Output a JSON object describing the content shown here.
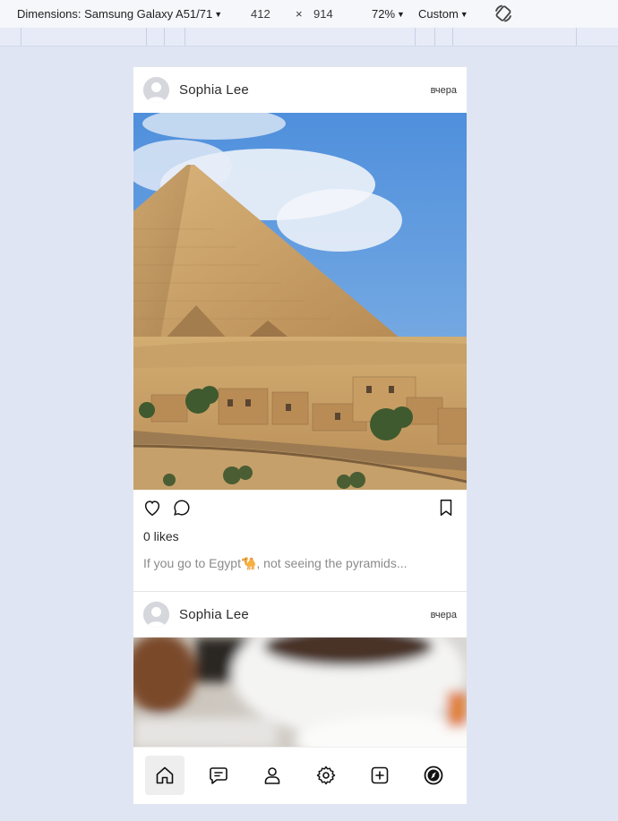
{
  "devtools": {
    "device_label": "Dimensions: Samsung Galaxy A51/71",
    "width": "412",
    "times": "×",
    "height": "914",
    "zoom": "72%",
    "throttle": "Custom",
    "icons": [
      "chevron-down-icon",
      "rotate-icon"
    ]
  },
  "posts": [
    {
      "username": "Sophia Lee",
      "timestamp": "вчера",
      "image": "great-pyramid-of-giza",
      "likes": "0 likes",
      "caption_before": "If you go to Egypt",
      "caption_emoji": "🐪",
      "caption_after": ", not seeing the pyramids..."
    },
    {
      "username": "Sophia Lee",
      "timestamp": "вчера",
      "image": "coffee-cup-blurred"
    }
  ],
  "nav": {
    "items": [
      "home-icon",
      "chat-icon",
      "user-icon",
      "settings-icon",
      "add-icon",
      "explore-icon"
    ],
    "active": "home-icon"
  },
  "colors": {
    "page_bg": "#dfe5f3",
    "sky": "#5f97d8",
    "sand": "#c9a46a"
  }
}
